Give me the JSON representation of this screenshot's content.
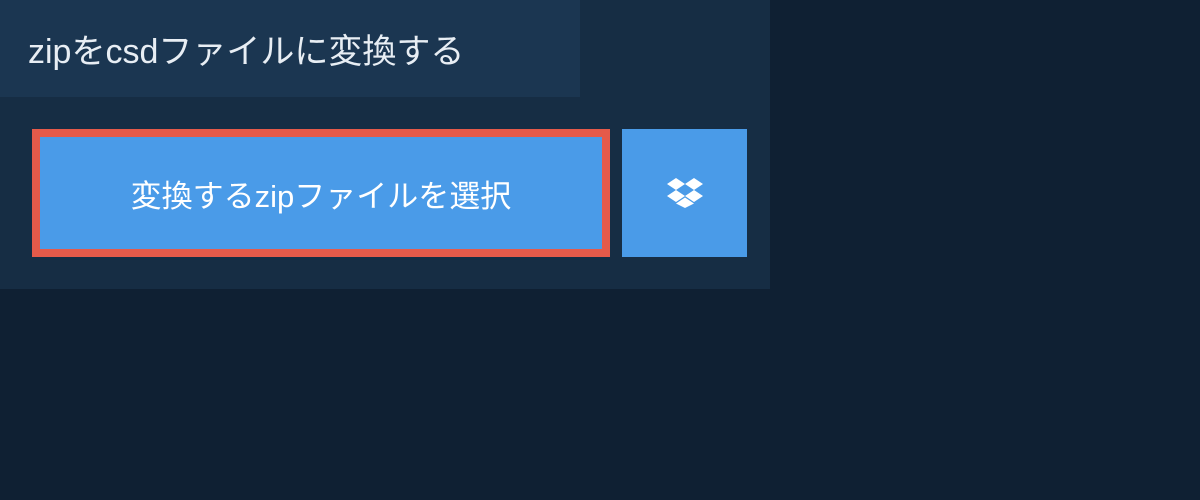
{
  "title": "zipをcsdファイルに変換する",
  "buttons": {
    "select_file": "変換するzipファイルを選択"
  }
}
